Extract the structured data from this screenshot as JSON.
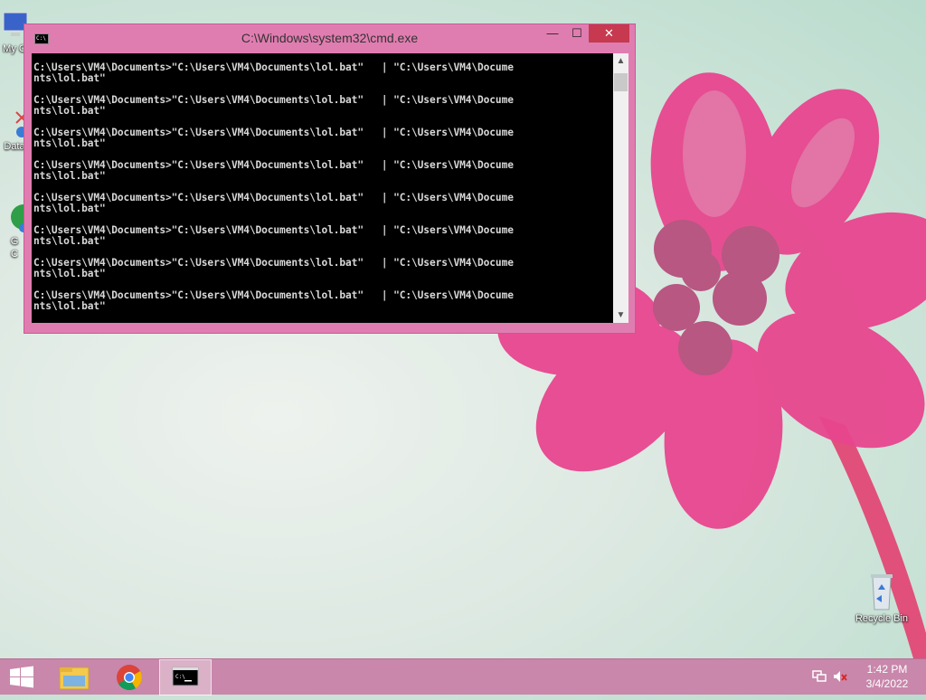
{
  "desktop": {
    "icons": [
      {
        "label": "My C"
      },
      {
        "label": "Data"
      },
      {
        "label": "G\nC"
      },
      {
        "label": "Recycle Bin"
      }
    ]
  },
  "cmd": {
    "title": "C:\\Windows\\system32\\cmd.exe",
    "minimize": "—",
    "maximize": "☐",
    "close": "✕",
    "lines": [
      {
        "a": "C:\\Users\\VM4\\Documents>\"C:\\Users\\VM4\\Documents\\lol.bat\"   | \"C:\\Users\\VM4\\Docume",
        "b": "nts\\lol.bat\""
      },
      {
        "a": "C:\\Users\\VM4\\Documents>\"C:\\Users\\VM4\\Documents\\lol.bat\"   | \"C:\\Users\\VM4\\Docume",
        "b": "nts\\lol.bat\""
      },
      {
        "a": "C:\\Users\\VM4\\Documents>\"C:\\Users\\VM4\\Documents\\lol.bat\"   | \"C:\\Users\\VM4\\Docume",
        "b": "nts\\lol.bat\""
      },
      {
        "a": "C:\\Users\\VM4\\Documents>\"C:\\Users\\VM4\\Documents\\lol.bat\"   | \"C:\\Users\\VM4\\Docume",
        "b": "nts\\lol.bat\""
      },
      {
        "a": "C:\\Users\\VM4\\Documents>\"C:\\Users\\VM4\\Documents\\lol.bat\"   | \"C:\\Users\\VM4\\Docume",
        "b": "nts\\lol.bat\""
      },
      {
        "a": "C:\\Users\\VM4\\Documents>\"C:\\Users\\VM4\\Documents\\lol.bat\"   | \"C:\\Users\\VM4\\Docume",
        "b": "nts\\lol.bat\""
      },
      {
        "a": "C:\\Users\\VM4\\Documents>\"C:\\Users\\VM4\\Documents\\lol.bat\"   | \"C:\\Users\\VM4\\Docume",
        "b": "nts\\lol.bat\""
      },
      {
        "a": "C:\\Users\\VM4\\Documents>\"C:\\Users\\VM4\\Documents\\lol.bat\"   | \"C:\\Users\\VM4\\Docume",
        "b": "nts\\lol.bat\""
      }
    ]
  },
  "taskbar": {
    "time": "1:42 PM",
    "date": "3/4/2022",
    "colors": {
      "taskbar": "#c887ab",
      "close_button": "#c7394f"
    }
  }
}
